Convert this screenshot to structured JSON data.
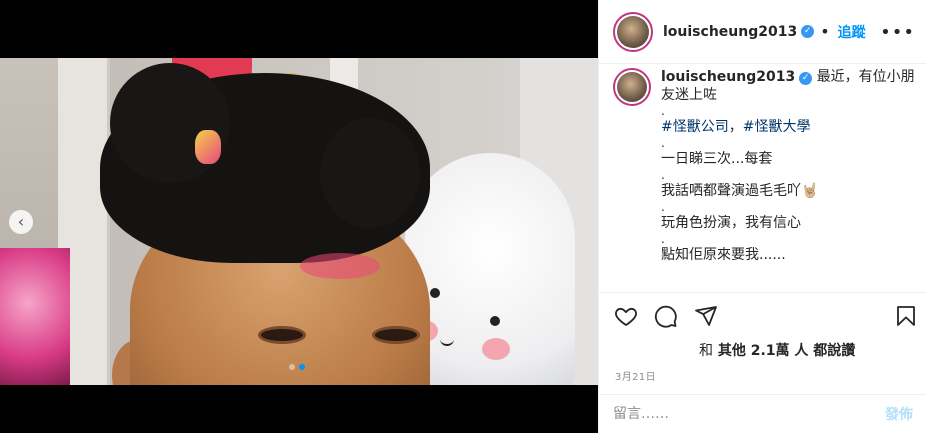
{
  "post": {
    "username": "louischeung2013",
    "verified_icon": "verified-badge-icon",
    "follow_label": "追蹤",
    "more_icon": "more-options-icon",
    "more_label": "•••"
  },
  "media": {
    "prev_icon": "chevron-left-icon",
    "prev_label": "‹",
    "carousel_dots": 2,
    "active_dot": 1
  },
  "caption": {
    "lines": [
      "最近，有位小朋友迷上咗",
      ".",
      "#怪獸公司，#怪獸大學",
      ".",
      "一日睇三次...每套",
      ".",
      "我話哂都聲演過毛毛吖🤘🏼",
      ".",
      "玩角色扮演，我有信心",
      ".",
      "點知佢原來要我......"
    ],
    "tags": [
      "#怪獸公司",
      "#怪獸大學"
    ]
  },
  "actions": {
    "like_icon": "heart-icon",
    "comment_icon": "comment-icon",
    "share_icon": "send-icon",
    "save_icon": "bookmark-icon"
  },
  "likes": {
    "prefix": "和",
    "text": "其他 2.1萬 人 都說讚"
  },
  "date": "3月21日",
  "comment": {
    "placeholder": "留言……",
    "post_label": "發佈"
  },
  "colors": {
    "accent": "#0095f6",
    "hashtag": "#00376b",
    "muted": "#8e8e8e",
    "post_disabled": "#b2dffc",
    "verified": "#3897f0"
  }
}
